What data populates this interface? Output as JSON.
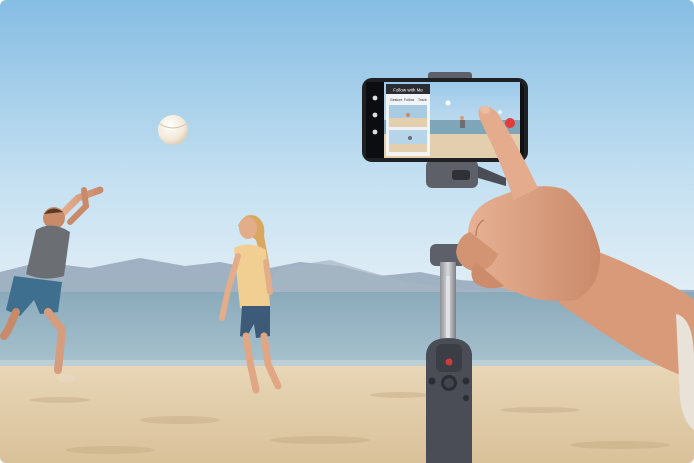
{
  "scene": {
    "setting": "beach",
    "subjects": [
      "child-jumping",
      "girl-standing",
      "volleyball",
      "hand-with-gimbal"
    ],
    "colors": {
      "sky_top": "#8fc2e6",
      "sky_bottom": "#d6e9f4",
      "sea": "#7fa6b8",
      "sand": "#e3cfae",
      "mountains": "#8a9fb3",
      "gimbal": "#4a4d55",
      "accent_record": "#e03a3a"
    }
  },
  "phone_screen": {
    "title": "Follow with Me",
    "tabs": [
      "Gesture",
      "Follow",
      "Track"
    ],
    "record_button": "record-icon"
  }
}
